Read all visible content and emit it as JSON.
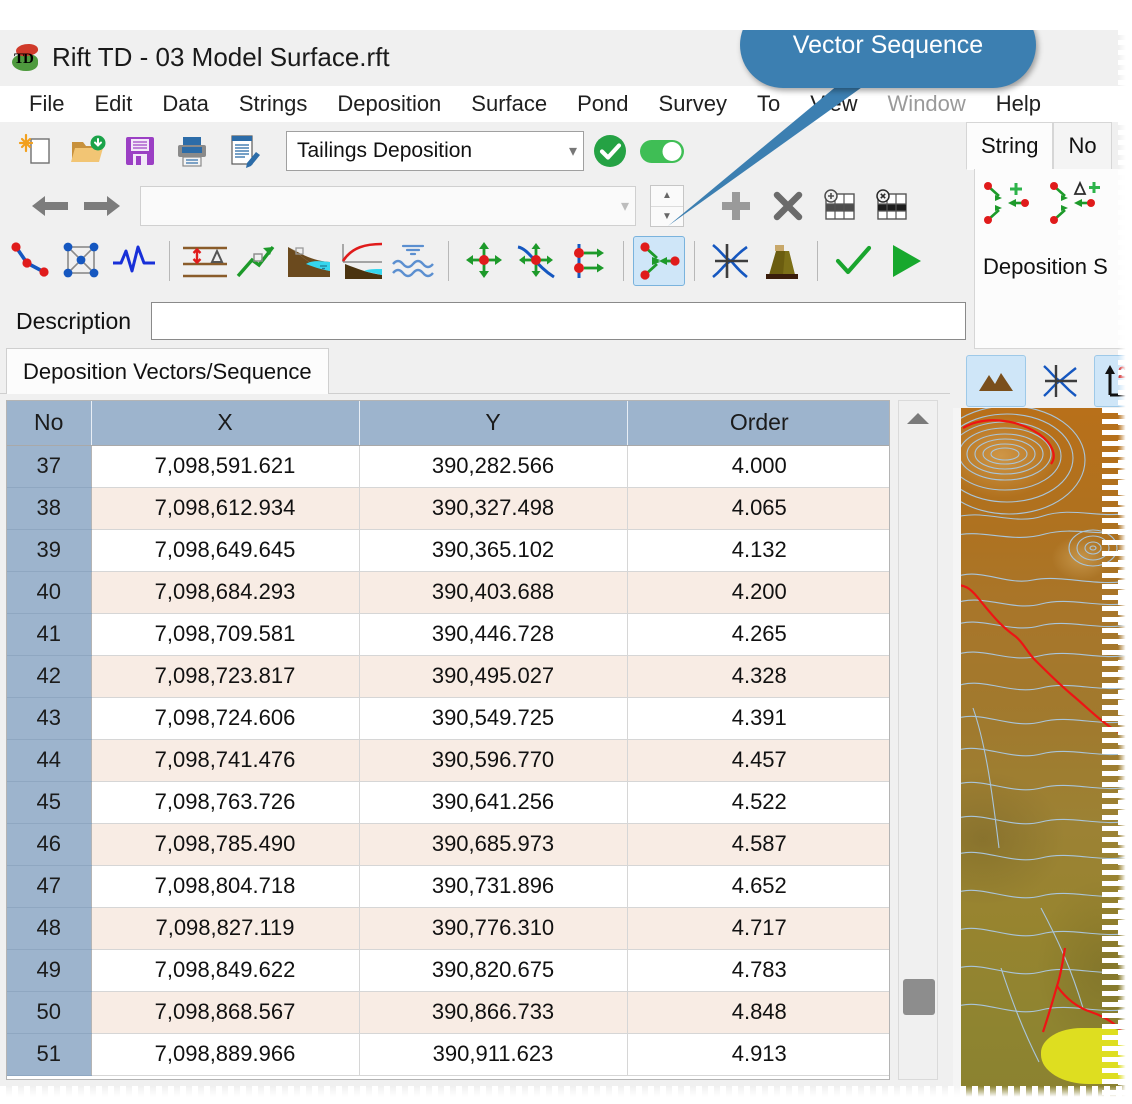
{
  "window": {
    "title": "Rift TD - 03 Model Surface.rft",
    "app_icon": "rift-td-logo"
  },
  "menu": [
    {
      "label": "File",
      "disabled": false
    },
    {
      "label": "Edit",
      "disabled": false
    },
    {
      "label": "Data",
      "disabled": false
    },
    {
      "label": "Strings",
      "disabled": false
    },
    {
      "label": "Deposition",
      "disabled": false
    },
    {
      "label": "Surface",
      "disabled": false
    },
    {
      "label": "Pond",
      "disabled": false
    },
    {
      "label": "Survey",
      "disabled": false
    },
    {
      "label": "To",
      "disabled": false
    },
    {
      "label": "View",
      "disabled": false
    },
    {
      "label": "Window",
      "disabled": true
    },
    {
      "label": "Help",
      "disabled": false
    }
  ],
  "toolbar": {
    "row1_icons": [
      "new-document-icon",
      "open-folder-icon",
      "save-icon",
      "print-icon",
      "edit-document-icon"
    ],
    "model_select": {
      "value": "Tailings Deposition",
      "chevron": "chevron-down-icon"
    },
    "accept_icon": "green-check-circle-icon",
    "toggle_icon": "toggle-on-icon",
    "row2_icons": [
      "back-arrow-icon",
      "forward-arrow-icon"
    ],
    "string_select": {
      "value": "",
      "placeholder": "",
      "chevron": "chevron-down-icon"
    },
    "spinner": {
      "up": "spinner-up-icon",
      "down": "spinner-down-icon"
    },
    "add_icon": "plus-icon",
    "delete_icon": "cross-icon",
    "insert_row_icon": "insert-row-icon",
    "delete_row_icon": "delete-row-icon",
    "row3_icons": [
      "polyline-icon",
      "mesh-icon",
      "waveform-icon",
      "elevation-delta-icon",
      "slope-arrow-icon",
      "beach-profile-icon",
      "beach-curve-icon",
      "water-waves-icon",
      "move-point-icon",
      "move-curve-icon",
      "offset-vector-icon",
      "vector-sequence-icon",
      "crosshair-curve-icon",
      "stack-icon",
      "check-icon",
      "play-icon"
    ],
    "active_icon": "vector-sequence-icon"
  },
  "description": {
    "label": "Description",
    "value": "",
    "placeholder": ""
  },
  "tab": {
    "label": "Deposition Vectors/Sequence"
  },
  "table": {
    "columns": [
      "No",
      "X",
      "Y",
      "Order"
    ],
    "rows": [
      {
        "no": "37",
        "x": "7,098,591.621",
        "y": "390,282.566",
        "order": "4.000"
      },
      {
        "no": "38",
        "x": "7,098,612.934",
        "y": "390,327.498",
        "order": "4.065"
      },
      {
        "no": "39",
        "x": "7,098,649.645",
        "y": "390,365.102",
        "order": "4.132"
      },
      {
        "no": "40",
        "x": "7,098,684.293",
        "y": "390,403.688",
        "order": "4.200"
      },
      {
        "no": "41",
        "x": "7,098,709.581",
        "y": "390,446.728",
        "order": "4.265"
      },
      {
        "no": "42",
        "x": "7,098,723.817",
        "y": "390,495.027",
        "order": "4.328"
      },
      {
        "no": "43",
        "x": "7,098,724.606",
        "y": "390,549.725",
        "order": "4.391"
      },
      {
        "no": "44",
        "x": "7,098,741.476",
        "y": "390,596.770",
        "order": "4.457"
      },
      {
        "no": "45",
        "x": "7,098,763.726",
        "y": "390,641.256",
        "order": "4.522"
      },
      {
        "no": "46",
        "x": "7,098,785.490",
        "y": "390,685.973",
        "order": "4.587"
      },
      {
        "no": "47",
        "x": "7,098,804.718",
        "y": "390,731.896",
        "order": "4.652"
      },
      {
        "no": "48",
        "x": "7,098,827.119",
        "y": "390,776.310",
        "order": "4.717"
      },
      {
        "no": "49",
        "x": "7,098,849.622",
        "y": "390,820.675",
        "order": "4.783"
      },
      {
        "no": "50",
        "x": "7,098,868.567",
        "y": "390,866.733",
        "order": "4.848"
      },
      {
        "no": "51",
        "x": "7,098,889.966",
        "y": "390,911.623",
        "order": "4.913"
      }
    ]
  },
  "scrollbar": {
    "up_arrow": "scroll-up-arrow-icon",
    "thumb": "scroll-thumb"
  },
  "right_panel": {
    "tabs": [
      {
        "label": "String",
        "selected": true
      },
      {
        "label": "No",
        "selected": false
      }
    ],
    "vector_icons": [
      "vector-add-icon",
      "vector-delta-add-icon"
    ],
    "section_label": "Deposition S",
    "view_buttons": [
      {
        "icon": "terrain-icon",
        "active": true
      },
      {
        "icon": "crosshair-curve-icon",
        "active": false
      },
      {
        "icon": "axes-2d-icon",
        "active": true
      }
    ]
  },
  "callout": {
    "text": "Vector Sequence",
    "color": "#3c7fb1"
  },
  "colors": {
    "accent_blue": "#3c7fb1",
    "header_blue": "#9db4cd",
    "alt_row": "#f8ece4",
    "toolbar_bg": "#f0f0f0",
    "active_button": "#cfe6f8",
    "green": "#2aa745",
    "map_terrain": "#a8762a",
    "map_contour": "#a8c4d8",
    "map_feature": "#ee1111",
    "map_highlight": "#dede20"
  }
}
